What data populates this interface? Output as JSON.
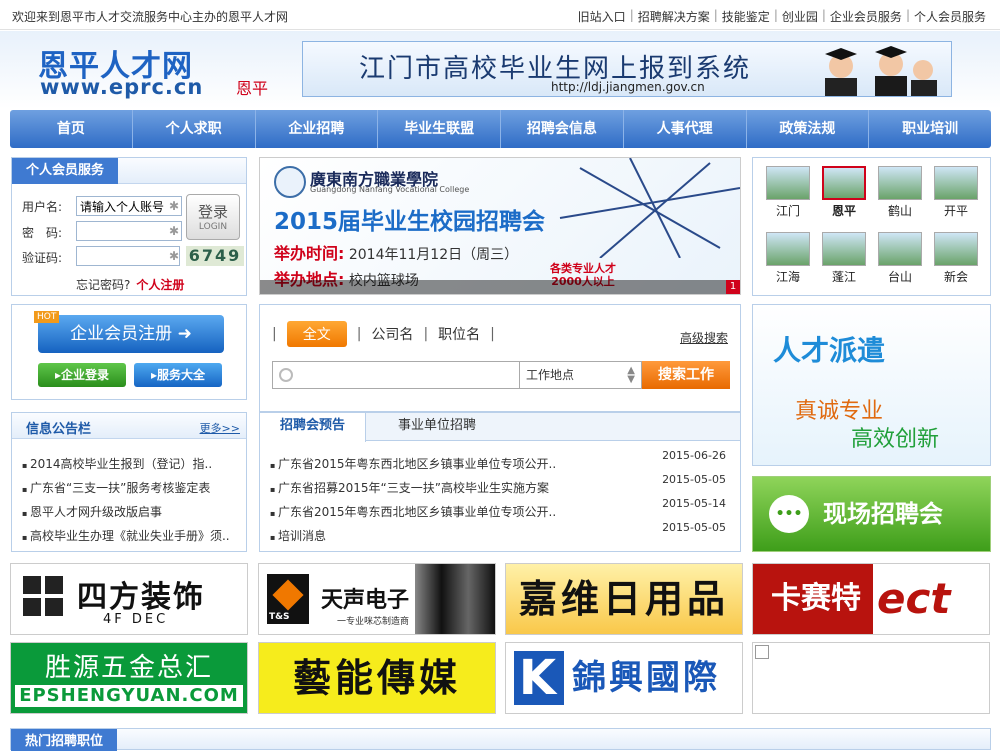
{
  "topbar": {
    "welcome": "欢迎来到恩平市人才交流服务中心主办的恩平人才网",
    "links": [
      "旧站入口",
      "招聘解决方案",
      "技能鉴定",
      "创业园",
      "企业会员服务",
      "个人会员服务"
    ]
  },
  "header": {
    "logo_cn": "恩平人才网",
    "logo_en": "www.eprc.cn",
    "city": "恩平",
    "banner_title": "江门市高校毕业生网上报到系统",
    "banner_url": "http://ldj.jiangmen.gov.cn"
  },
  "nav": [
    "首页",
    "个人求职",
    "企业招聘",
    "毕业生联盟",
    "招聘会信息",
    "人事代理",
    "政策法规",
    "职业培训"
  ],
  "login": {
    "title": "个人会员服务",
    "user_label": "用户名:",
    "user_placeholder": "请输入个人账号",
    "pass_label": "密　码:",
    "code_label": "验证码:",
    "captcha": "6749",
    "login_btn": "登录",
    "login_btn_en": "LOGIN",
    "forgot": "忘记密码?",
    "register": "个人注册"
  },
  "campus_banner": {
    "school": "廣東南方職業學院",
    "school_en": "Guangdong Nanfang Vocational College",
    "title": "2015届毕业生校园招聘会",
    "time_label": "举办时间:",
    "time": "2014年11月12日（周三）",
    "place_label": "举办地点:",
    "place": "校内篮球场",
    "tag1": "各类专业人才",
    "tag2": "2000人以上",
    "index": "1"
  },
  "cities": [
    {
      "name": "江门",
      "selected": false
    },
    {
      "name": "恩平",
      "selected": true
    },
    {
      "name": "鹤山",
      "selected": false
    },
    {
      "name": "开平",
      "selected": false
    },
    {
      "name": "江海",
      "selected": false
    },
    {
      "name": "蓬江",
      "selected": false
    },
    {
      "name": "台山",
      "selected": false
    },
    {
      "name": "新会",
      "selected": false
    }
  ],
  "enterprise": {
    "register": "企业会员注册",
    "hot": "HOT",
    "login": "企业登录",
    "services": "服务大全"
  },
  "search": {
    "tabs": [
      "全文",
      "公司名",
      "职位名"
    ],
    "advanced": "高级搜索",
    "location": "工作地点",
    "button": "搜索工作"
  },
  "notice": {
    "title": "信息公告栏",
    "more": "更多>>",
    "items": [
      "2014高校毕业生报到（登记）指..",
      "广东省“三支一扶”服务考核鉴定表",
      "恩平人才网升级改版启事",
      "高校毕业生办理《就业失业手册》须.."
    ]
  },
  "jobfair": {
    "tabs": [
      "招聘会预告",
      "事业单位招聘"
    ],
    "items": [
      {
        "title": "广东省2015年粤东西北地区乡镇事业单位专项公开..",
        "date": "2015-06-26"
      },
      {
        "title": "广东省招募2015年“三支一扶”高校毕业生实施方案",
        "date": "2015-05-05"
      },
      {
        "title": "广东省2015年粤东西北地区乡镇事业单位专项公开..",
        "date": "2015-05-14"
      },
      {
        "title": "培训消息",
        "date": "2015-05-05"
      }
    ]
  },
  "right_ads": {
    "paiqian": "人才派遣",
    "line1": "真诚专业",
    "line2": "高效创新",
    "xianchang": "现场招聘会"
  },
  "logo_ads": {
    "ad1": "四方装饰",
    "ad1_sub": "4F DEC",
    "ad2": "天声电子",
    "ad2_sub": "一专业咪芯制造商",
    "ad2_mark": "T&S",
    "ad3": "嘉维日用品",
    "ad4": "卡赛特",
    "ad4_sub": "ect",
    "ad5": "胜源五金总汇",
    "ad5_sub": "EPSHENGYUAN.COM",
    "ad6": "藝能傳媒",
    "ad7": "錦興國際",
    "ad7_mark": "K"
  },
  "hotjobs": {
    "title": "热门招聘职位"
  }
}
